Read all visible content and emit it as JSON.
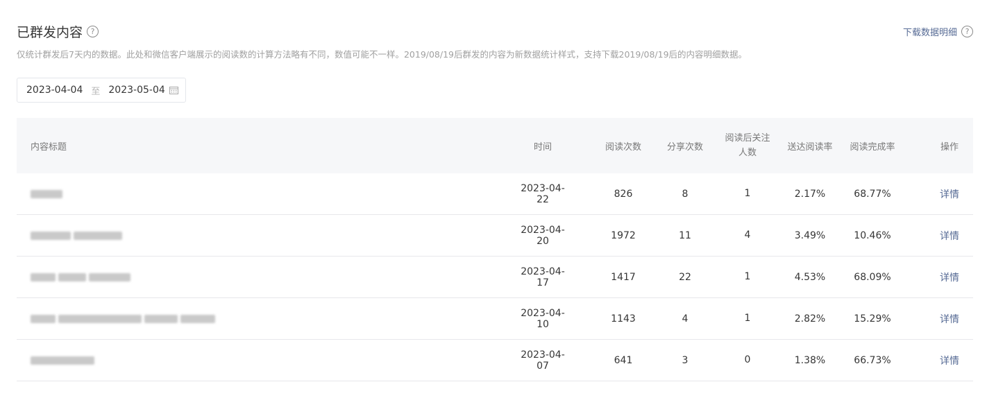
{
  "header": {
    "title": "已群发内容",
    "help_glyph": "?",
    "download_label": "下载数据明细",
    "description": "仅统计群发后7天内的数据。此处和微信客户端展示的阅读数的计算方法略有不同，数值可能不一样。2019/08/19后群发的内容为新数据统计样式，支持下载2019/08/19后的内容明细数据。"
  },
  "date_range": {
    "start": "2023-04-04",
    "separator": "至",
    "end": "2023-05-04",
    "icon": "calendar-icon"
  },
  "table": {
    "columns": {
      "title": "内容标题",
      "time": "时间",
      "reads": "阅读次数",
      "shares": "分享次数",
      "follows_line1": "阅读后关注",
      "follows_line2": "人数",
      "delivery_rate": "送达阅读率",
      "completion_rate": "阅读完成率",
      "operation": "操作"
    },
    "rows": [
      {
        "time": "2023-04-22",
        "reads": "826",
        "shares": "8",
        "follows": "1",
        "delivery_rate": "2.17%",
        "completion_rate": "68.77%",
        "action": "详情"
      },
      {
        "time": "2023-04-20",
        "reads": "1972",
        "shares": "11",
        "follows": "4",
        "delivery_rate": "3.49%",
        "completion_rate": "10.46%",
        "action": "详情"
      },
      {
        "time": "2023-04-17",
        "reads": "1417",
        "shares": "22",
        "follows": "1",
        "delivery_rate": "4.53%",
        "completion_rate": "68.09%",
        "action": "详情"
      },
      {
        "time": "2023-04-10",
        "reads": "1143",
        "shares": "4",
        "follows": "1",
        "delivery_rate": "2.82%",
        "completion_rate": "15.29%",
        "action": "详情"
      },
      {
        "time": "2023-04-07",
        "reads": "641",
        "shares": "3",
        "follows": "0",
        "delivery_rate": "1.38%",
        "completion_rate": "66.73%",
        "action": "详情"
      }
    ]
  },
  "colors": {
    "link": "#576b95",
    "header_bg": "#f6f7f9",
    "muted_text": "#a0a0a0",
    "border": "#e7e7eb"
  }
}
